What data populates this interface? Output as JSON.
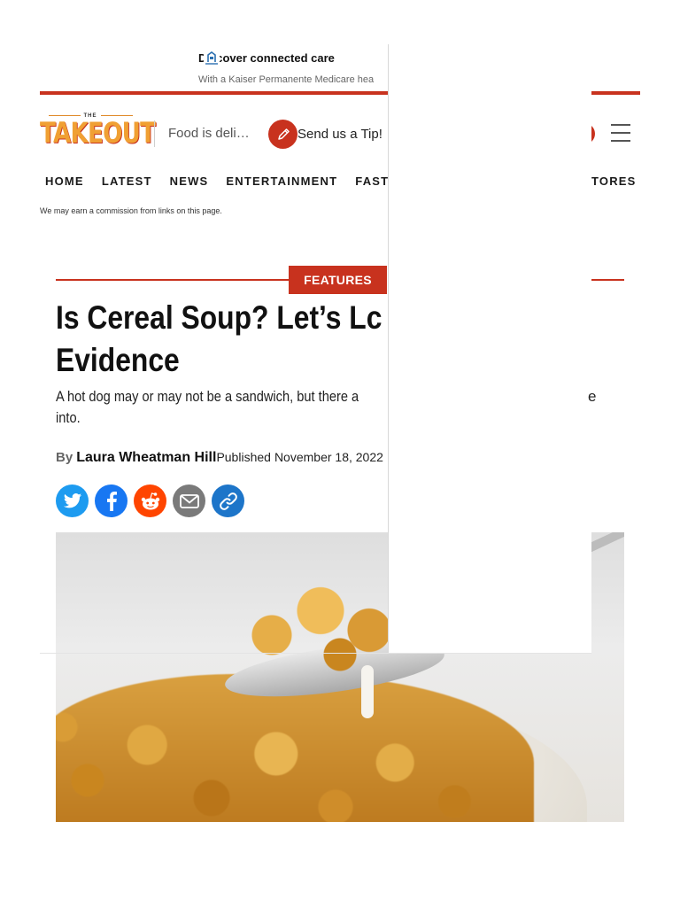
{
  "ad": {
    "title": "Discover connected care",
    "subtitle": "With a Kaiser Permanente Medicare hea"
  },
  "header": {
    "logo_small": "THE",
    "logo_main": "TAKEOUT",
    "tagline": "Food is deli…",
    "tip_label": "Send us a Tip!"
  },
  "nav": {
    "items": [
      "HOME",
      "LATEST",
      "NEWS",
      "ENTERTAINMENT",
      "FAST FOC"
    ],
    "right_item": "TORES"
  },
  "disclaimer": "We may earn a commission from links on this page.",
  "article": {
    "category": "FEATURES",
    "headline": "Is Cereal Soup? Let’s Lc Evidence",
    "headline_line1": "Is Cereal Soup? Let’s Lc",
    "headline_line2": "Evidence",
    "subhead_line1": "A hot dog may or may not be a sandwich, but there a",
    "subhead_line2": "into.",
    "subhead_edge": "e",
    "by_label": "By",
    "author": "Laura Wheatman Hill",
    "published_label": "Published",
    "published_date": "November 18, 2022"
  },
  "share": {
    "icons": [
      "twitter-icon",
      "facebook-icon",
      "reddit-icon",
      "email-icon",
      "link-icon"
    ]
  },
  "colors": {
    "accent": "#c8321e",
    "logo": "#f0a033",
    "twitter": "#1d9bf0",
    "facebook": "#1877f2",
    "reddit": "#ff4500"
  }
}
